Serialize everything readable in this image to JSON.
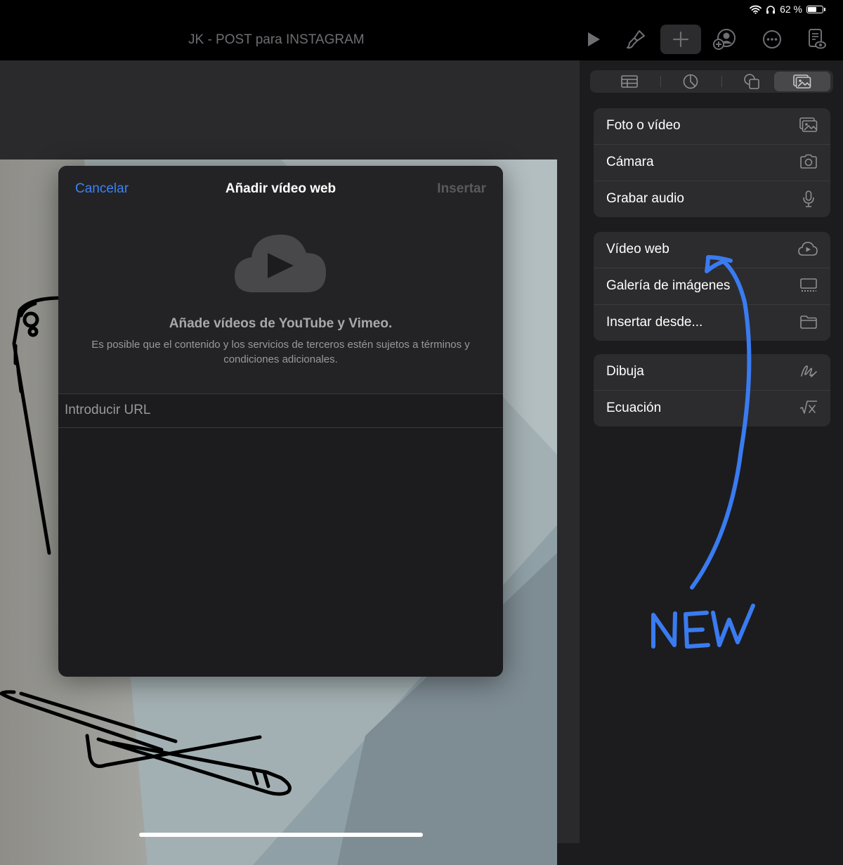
{
  "status": {
    "battery": "62 %",
    "battery_level": 0.62
  },
  "toolbar": {
    "title": "JK - POST para INSTAGRAM"
  },
  "dialog": {
    "cancel": "Cancelar",
    "title": "Añadir vídeo web",
    "insert": "Insertar",
    "heading": "Añade vídeos de YouTube y Vimeo.",
    "subtext": "Es posible que el contenido y los servicios de terceros estén sujetos a términos y condiciones adicionales.",
    "url_placeholder": "Introducir URL"
  },
  "panel": {
    "tabs": [
      {
        "icon": "table-icon"
      },
      {
        "icon": "chart-icon"
      },
      {
        "icon": "shapes-icon"
      },
      {
        "icon": "media-icon",
        "selected": true
      }
    ],
    "groups": [
      [
        {
          "label": "Foto o vídeo",
          "icon": "photo-icon"
        },
        {
          "label": "Cámara",
          "icon": "camera-icon"
        },
        {
          "label": "Grabar audio",
          "icon": "microphone-icon"
        }
      ],
      [
        {
          "label": "Vídeo web",
          "icon": "cloud-play-icon"
        },
        {
          "label": "Galería de imágenes",
          "icon": "gallery-icon"
        },
        {
          "label": "Insertar desde...",
          "icon": "folder-icon"
        }
      ],
      [
        {
          "label": "Dibuja",
          "icon": "drawing-icon"
        },
        {
          "label": "Ecuación",
          "icon": "equation-icon"
        }
      ]
    ]
  },
  "annotation": {
    "text": "NEW",
    "color": "#3a7bf0"
  }
}
